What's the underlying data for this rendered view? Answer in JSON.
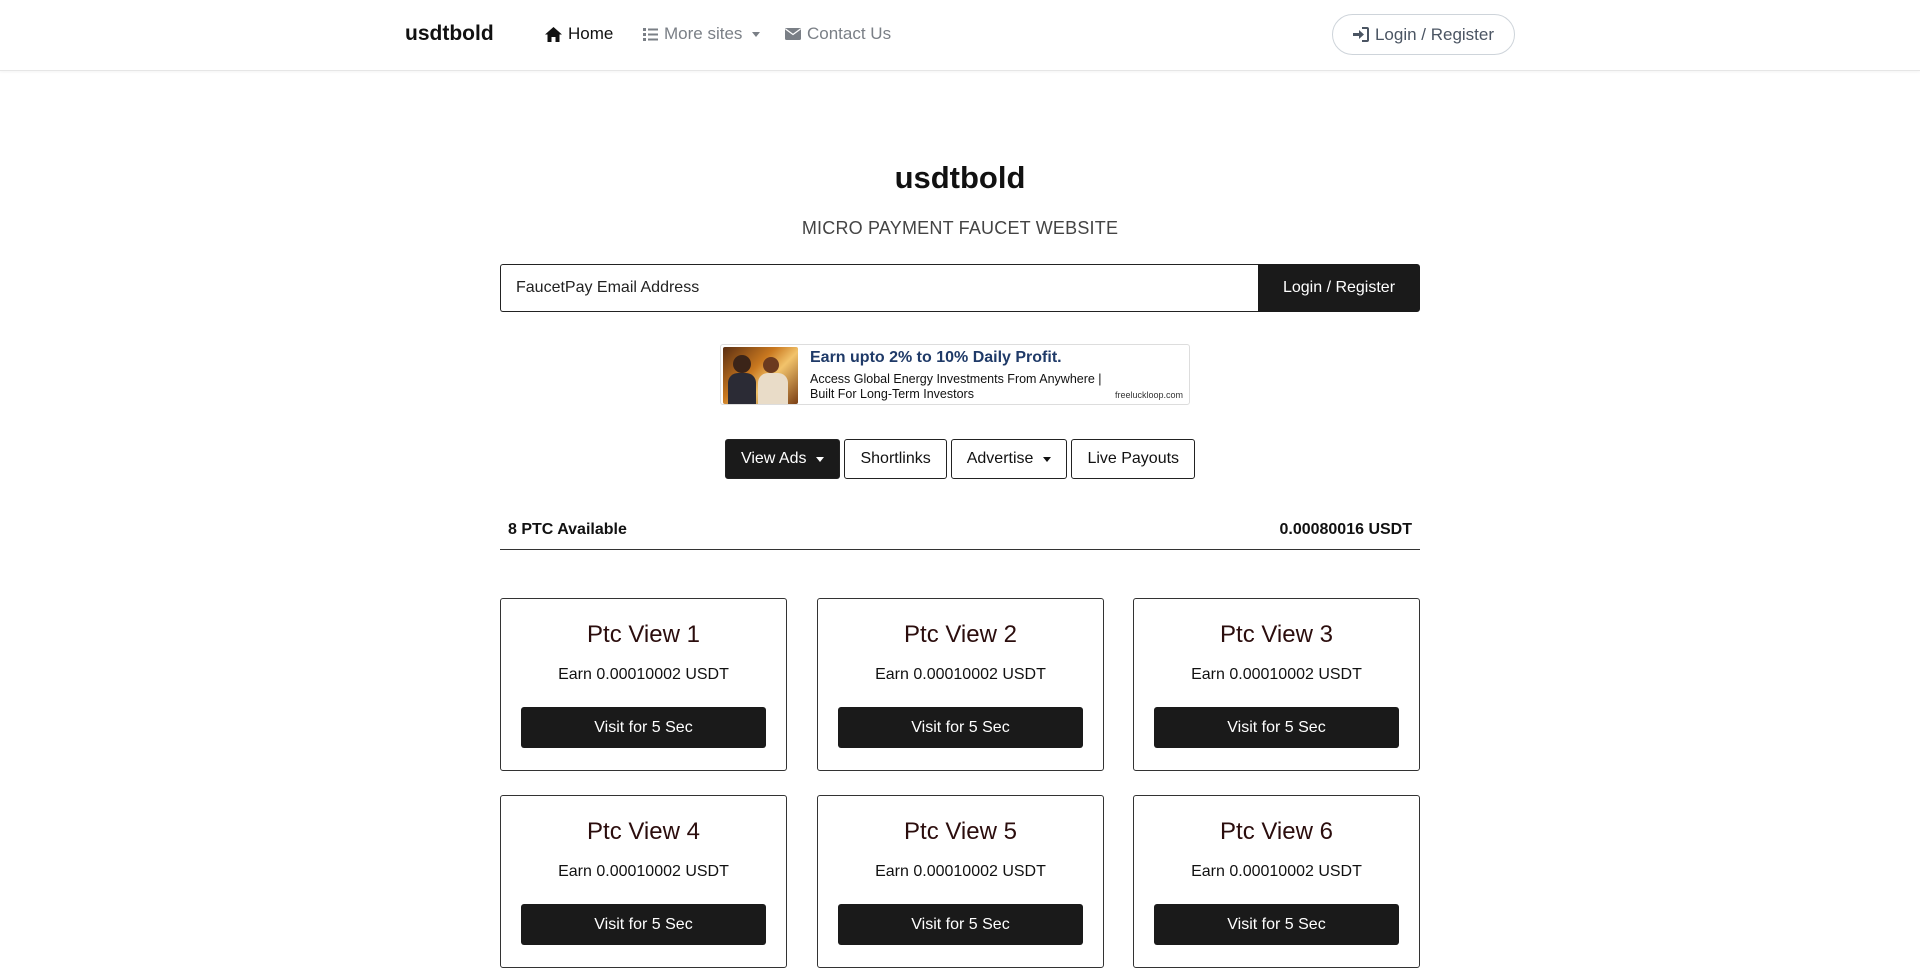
{
  "navbar": {
    "brand": "usdtbold",
    "home_label": "Home",
    "more_sites_label": "More sites",
    "contact_label": "Contact Us",
    "login_label": "Login / Register"
  },
  "hero": {
    "title": "usdtbold",
    "subtitle": "MICRO PAYMENT FAUCET WEBSITE"
  },
  "login_form": {
    "email_placeholder": "FaucetPay Email Address",
    "submit_label": "Login / Register"
  },
  "ad": {
    "title": "Earn upto 2% to 10% Daily Profit.",
    "description": "Access Global Energy Investments From Anywhere | Built For Long-Term Investors",
    "domain": "freeluckloop.com"
  },
  "tabs": {
    "view_ads": "View Ads",
    "shortlinks": "Shortlinks",
    "advertise": "Advertise",
    "live_payouts": "Live Payouts"
  },
  "ptc": {
    "available": "8 PTC Available",
    "total": "0.00080016 USDT",
    "cards": [
      {
        "title": "Ptc View 1",
        "earn": "Earn 0.00010002 USDT",
        "button": "Visit for 5 Sec"
      },
      {
        "title": "Ptc View 2",
        "earn": "Earn 0.00010002 USDT",
        "button": "Visit for 5 Sec"
      },
      {
        "title": "Ptc View 3",
        "earn": "Earn 0.00010002 USDT",
        "button": "Visit for 5 Sec"
      },
      {
        "title": "Ptc View 4",
        "earn": "Earn 0.00010002 USDT",
        "button": "Visit for 5 Sec"
      },
      {
        "title": "Ptc View 5",
        "earn": "Earn 0.00010002 USDT",
        "button": "Visit for 5 Sec"
      },
      {
        "title": "Ptc View 6",
        "earn": "Earn 0.00010002 USDT",
        "button": "Visit for 5 Sec"
      }
    ]
  }
}
